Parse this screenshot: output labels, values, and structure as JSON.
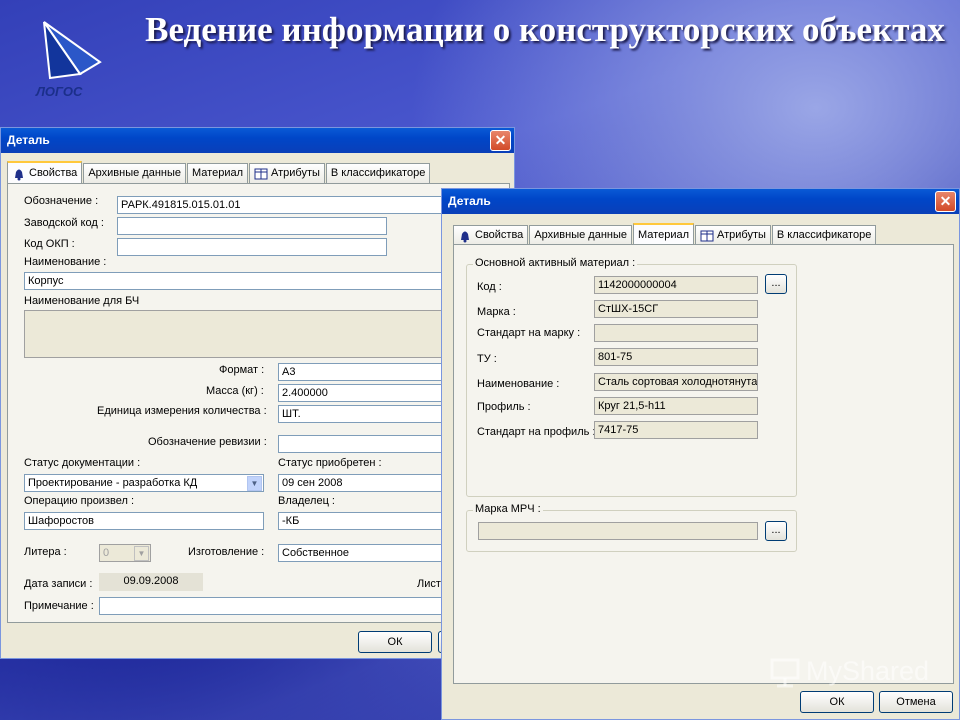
{
  "slide": {
    "title": "Ведение информации о конструкторских объектах",
    "logo_text": "ЛОГОС",
    "watermark": "MyShared"
  },
  "dialog1": {
    "title": "Деталь",
    "tabs": [
      "Свойства",
      "Архивные данные",
      "Материал",
      "Атрибуты",
      "В классификаторе"
    ],
    "active_tab": 0,
    "labels": {
      "designation": "Обозначение :",
      "factory_code": "Заводской код :",
      "okp_code": "Код ОКП :",
      "name": "Наименование :",
      "name_bch": "Наименование для БЧ",
      "format": "Формат :",
      "mass": "Масса (кг) :",
      "unit": "Единица измерения количества :",
      "revision": "Обозначение ревизии :",
      "doc_status": "Статус документации :",
      "acq_status": "Статус приобретен :",
      "operator": "Операцию произвел :",
      "owner": "Владелец :",
      "litera": "Литера :",
      "manufacture": "Изготовление :",
      "record_date": "Дата записи :",
      "sheets": "Лист",
      "note": "Примечание :"
    },
    "values": {
      "designation": "РАРК.491815.015.01.01",
      "factory_code": "",
      "okp_code": "",
      "name": "Корпус",
      "name_bch": "",
      "format": "А3",
      "mass": "2.400000",
      "unit": "ШТ.",
      "revision": "",
      "doc_status": "Проектирование - разработка КД",
      "acq_status": "09 сен 2008",
      "operator": "Шафоростов",
      "owner": "-КБ",
      "litera": "0",
      "manufacture": "Собственное",
      "record_date": "09.09.2008",
      "note": ""
    },
    "ok": "ОК"
  },
  "dialog2": {
    "title": "Деталь",
    "tabs": [
      "Свойства",
      "Архивные данные",
      "Материал",
      "Атрибуты",
      "В классификаторе"
    ],
    "active_tab": 2,
    "group_main": "Основной активный материал :",
    "group_mrch": "Марка МРЧ :",
    "labels": {
      "code": "Код :",
      "brand": "Марка :",
      "brand_std": "Стандарт на марку :",
      "tu": "ТУ :",
      "name": "Наименование :",
      "profile": "Профиль :",
      "profile_std": "Стандарт на профиль :"
    },
    "values": {
      "code": "1142000000004",
      "brand": "СтШХ-15СГ",
      "brand_std": "",
      "tu": "801-75",
      "name": "Сталь сортовая холоднотянута",
      "profile": "Круг 21,5-h11",
      "profile_std": "7417-75",
      "mrch": ""
    },
    "browse": "...",
    "ok": "ОК",
    "cancel": "Отмена"
  },
  "colors": {
    "titlebar": "#0a4fd0",
    "dialog_bg": "#ece9d8",
    "slide_bg": "#3a46bd"
  }
}
